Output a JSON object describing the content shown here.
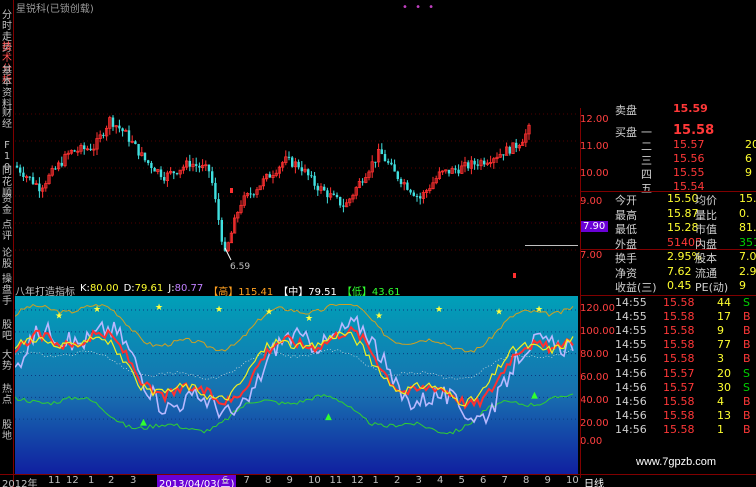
{
  "window": {
    "title": "星锐科(已锁创载)",
    "dots": "• • •"
  },
  "left_tabs": [
    "分时走势",
    "技术分析",
    "基本资料",
    "财经",
    "F10",
    "同花顺",
    "资金",
    "点评",
    "论股",
    "操盘手",
    "股吧",
    "大势",
    "热点",
    "股地"
  ],
  "price_axis": [
    "12.00",
    "11.00",
    "10.00",
    "9.00",
    "8.00",
    "7.00"
  ],
  "price_last": "7.90",
  "price_low_label": "6.59",
  "indicator": {
    "name": "八年打造指标",
    "k_label": "K:",
    "k_value": "80.00",
    "d_label": "D:",
    "d_value": "79.61",
    "j_label": "J:",
    "j_value": "80.77",
    "high_label": "【高】",
    "high_value": "115.41",
    "mid_label": "【中】",
    "mid_value": "79.51",
    "low_label": "【低】",
    "low_value": "43.61",
    "axis": [
      "120.00",
      "100.00",
      "80.00",
      "60.00",
      "40.00",
      "20.00",
      "0.00"
    ]
  },
  "bottom_bar": {
    "year": "2012年",
    "months": [
      "11",
      "12",
      "1",
      "2",
      "3"
    ],
    "date_highlight": "2013/04/03(三)",
    "months2": [
      "6",
      "7",
      "8",
      "9",
      "10",
      "11",
      "12",
      "1",
      "2",
      "3",
      "4",
      "5",
      "6",
      "7",
      "8",
      "9",
      "10"
    ],
    "period": "日线"
  },
  "quote_panel": {
    "top_label": "卖盘",
    "top_price": "15.59",
    "buy_label": "买盘",
    "buy_rows": [
      {
        "level": "一",
        "price": "15.58",
        "vol": ""
      },
      {
        "level": "二",
        "price": "15.57",
        "vol": "20"
      },
      {
        "level": "三",
        "price": "15.56",
        "vol": "6"
      },
      {
        "level": "四",
        "price": "15.55",
        "vol": "9"
      },
      {
        "level": "五",
        "price": "15.54",
        "vol": ""
      }
    ],
    "stats": [
      {
        "l1": "今开",
        "v1": "15.50",
        "l2": "均价",
        "v2": "15."
      },
      {
        "l1": "最高",
        "v1": "15.87",
        "l2": "量比",
        "v2": "0."
      },
      {
        "l1": "最低",
        "v1": "15.28",
        "l2": "市值",
        "v2": "81.6"
      },
      {
        "l1": "外盘",
        "v1": "51405",
        "l2": "内盘",
        "v2": "351"
      },
      {
        "l1": "换手",
        "v1": "2.95%",
        "l2": "股本",
        "v2": "7.04"
      },
      {
        "l1": "净资",
        "v1": "7.62",
        "l2": "流通",
        "v2": "2.93"
      },
      {
        "l1": "收益(三)",
        "v1": "0.45",
        "l2": "PE(动)",
        "v2": "9"
      }
    ],
    "ticks": [
      {
        "time": "14:55",
        "price": "15.58",
        "vol": "44",
        "side": "S"
      },
      {
        "time": "14:55",
        "price": "15.58",
        "vol": "17",
        "side": "B"
      },
      {
        "time": "14:55",
        "price": "15.58",
        "vol": "9",
        "side": "B"
      },
      {
        "time": "14:55",
        "price": "15.58",
        "vol": "77",
        "side": "B"
      },
      {
        "time": "14:56",
        "price": "15.58",
        "vol": "3",
        "side": "B"
      },
      {
        "time": "14:56",
        "price": "15.57",
        "vol": "20",
        "side": "S"
      },
      {
        "time": "14:56",
        "price": "15.57",
        "vol": "30",
        "side": "S"
      },
      {
        "time": "14:56",
        "price": "15.58",
        "vol": "4",
        "side": "B"
      },
      {
        "time": "14:56",
        "price": "15.58",
        "vol": "13",
        "side": "B"
      },
      {
        "time": "14:56",
        "price": "15.58",
        "vol": "1",
        "side": "B"
      }
    ]
  },
  "watermark": "www.7gpzb.com",
  "colors": {
    "up": "#ff3030",
    "down": "#40e0e0",
    "bg_gradient_top": "#00a0b8",
    "bg_gradient_bottom": "#1020a0",
    "buy": "#ff3838",
    "sell": "#00d000"
  }
}
